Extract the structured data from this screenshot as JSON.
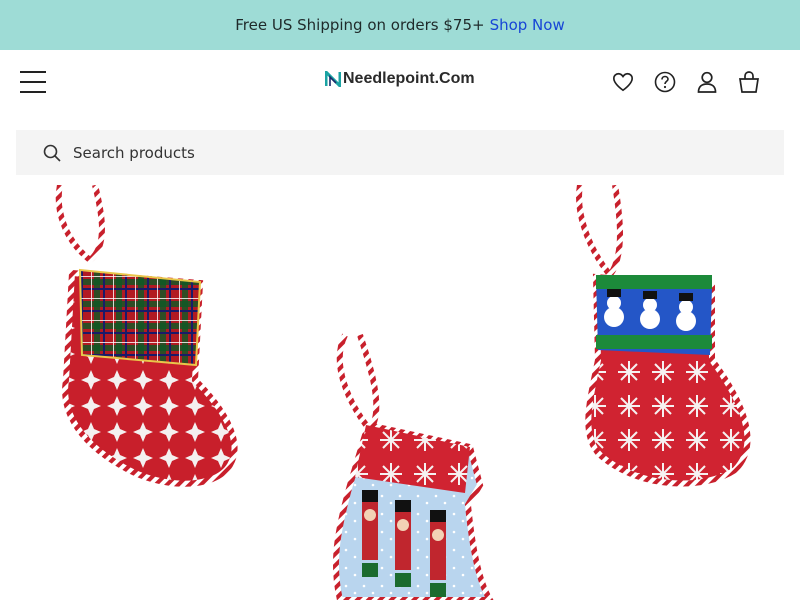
{
  "promo": {
    "text": "Free US Shipping on orders $75+",
    "link_text": "Shop Now"
  },
  "header": {
    "logo_text": "Needlepoint.Com",
    "menu_icon": "hamburger-menu-icon",
    "icons": [
      "heart-icon",
      "help-icon",
      "account-icon",
      "shopping-bag-icon"
    ]
  },
  "search": {
    "placeholder": "Search products"
  },
  "colors": {
    "promo_bg": "#9edcd6",
    "link": "#1745d6",
    "logo_accent": "#1aa3a3",
    "search_bg": "#f4f4f4"
  },
  "hero": {
    "images": [
      "plaid-stocking-ornament",
      "nutcracker-stocking-ornament",
      "snowman-stocking-ornament"
    ]
  }
}
